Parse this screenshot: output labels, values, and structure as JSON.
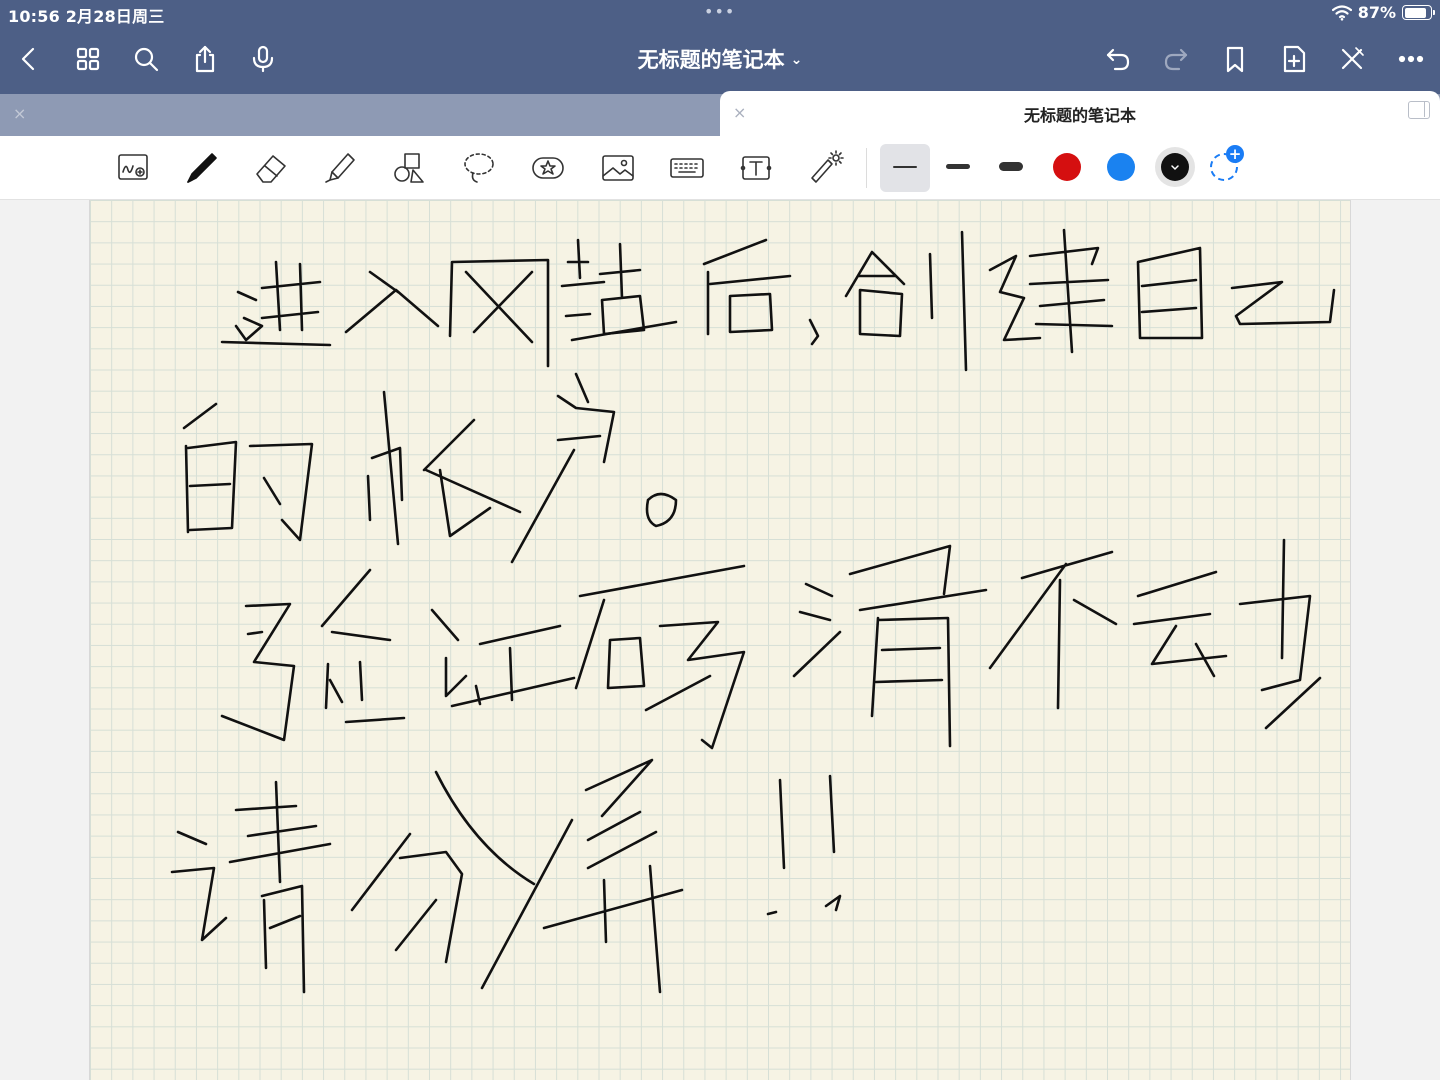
{
  "status_bar": {
    "time_date": "10:56   2月28日周三",
    "more_dots": "•••",
    "battery_percent": "87%",
    "battery_level": 0.87,
    "wifi_icon": "wifi-icon"
  },
  "nav_bar": {
    "title": "无标题的笔记本",
    "title_chevron": "⌄",
    "left_icons": [
      "back-icon",
      "grid-icon",
      "search-icon",
      "share-icon",
      "microphone-icon"
    ],
    "right_icons": [
      "undo-icon",
      "redo-icon",
      "bookmark-icon",
      "add-page-icon",
      "close-tools-icon",
      "more-icon"
    ]
  },
  "tabs": {
    "active_title": "无标题的笔记本",
    "close_glyph": "×"
  },
  "toolbar": {
    "tools": [
      "handwriting-zoom-icon",
      "pen-icon",
      "eraser-icon",
      "highlighter-icon",
      "shapes-icon",
      "lasso-icon",
      "sticker-icon",
      "image-icon",
      "keyboard-icon",
      "text-box-icon",
      "laser-pointer-icon"
    ],
    "colors": [
      "#d50f10",
      "#1a82f0",
      "#111111"
    ],
    "selected_color": "#111111",
    "add_color_glyph": "+"
  },
  "note": {
    "handwritten_lines": [
      "进入网站后，创建自己",
      "的帐户。",
      "验证码滑不动",
      "请分析！！"
    ]
  }
}
